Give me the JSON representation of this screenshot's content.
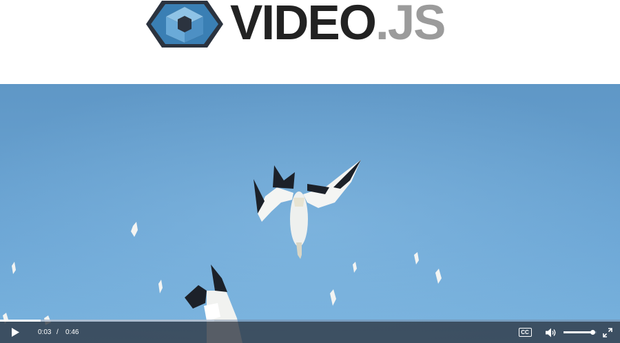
{
  "logo": {
    "word": "VIDEO",
    "dot": ".",
    "ext": "JS",
    "colors": {
      "word": "#222222",
      "ext": "#9b9b9b",
      "mark_outer": "#2b333f",
      "mark_light": "#8fc3e6",
      "mark_mid": "#5a9fd0",
      "mark_dark": "#3a7fb4"
    }
  },
  "player": {
    "scene": "gannets diving against a blue sky",
    "progress": {
      "played_fraction": 0.065,
      "buffered_fraction": 0.345
    },
    "time": {
      "current": "0:03",
      "divider": "/",
      "duration": "0:46"
    },
    "captions_label": "CC",
    "volume_level": 0.9,
    "icons": {
      "play": "play-icon",
      "captions": "captions-icon",
      "volume": "volume-high-icon",
      "fullscreen": "fullscreen-icon"
    },
    "colors": {
      "control_bar": "#2b333f",
      "sky_top": "#5f97c6",
      "sky_bottom": "#77b0dc"
    }
  }
}
